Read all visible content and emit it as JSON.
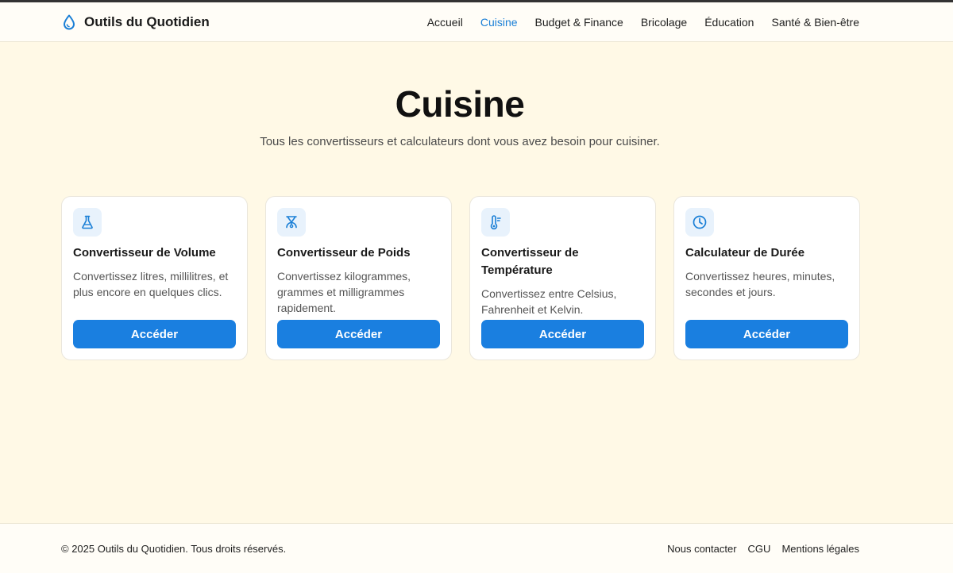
{
  "header": {
    "brand": "Outils du Quotidien",
    "brand_icon": "droplet-icon",
    "nav": [
      {
        "label": "Accueil",
        "active": false
      },
      {
        "label": "Cuisine",
        "active": true
      },
      {
        "label": "Budget & Finance",
        "active": false
      },
      {
        "label": "Bricolage",
        "active": false
      },
      {
        "label": "Éducation",
        "active": false
      },
      {
        "label": "Santé & Bien-être",
        "active": false
      }
    ]
  },
  "hero": {
    "title": "Cuisine",
    "subtitle": "Tous les convertisseurs et calculateurs dont vous avez besoin pour cuisiner."
  },
  "cards": [
    {
      "icon": "flask-icon",
      "title": "Convertisseur de Volume",
      "description": "Convertissez litres, millilitres, et plus encore en quelques clics.",
      "button": "Accéder"
    },
    {
      "icon": "scale-icon",
      "title": "Convertisseur de Poids",
      "description": "Convertissez kilogrammes, grammes et milligrammes rapidement.",
      "button": "Accéder"
    },
    {
      "icon": "thermometer-icon",
      "title": "Convertisseur de Température",
      "description": "Convertissez entre Celsius, Fahrenheit et Kelvin.",
      "button": "Accéder"
    },
    {
      "icon": "clock-icon",
      "title": "Calculateur de Durée",
      "description": "Convertissez heures, minutes, secondes et jours.",
      "button": "Accéder"
    }
  ],
  "footer": {
    "copyright": "© 2025 Outils du Quotidien. Tous droits réservés.",
    "links": [
      "Nous contacter",
      "CGU",
      "Mentions légales"
    ]
  },
  "colors": {
    "accent": "#1a7fd6",
    "button": "#1a7fe0",
    "background": "#fff9e6"
  }
}
